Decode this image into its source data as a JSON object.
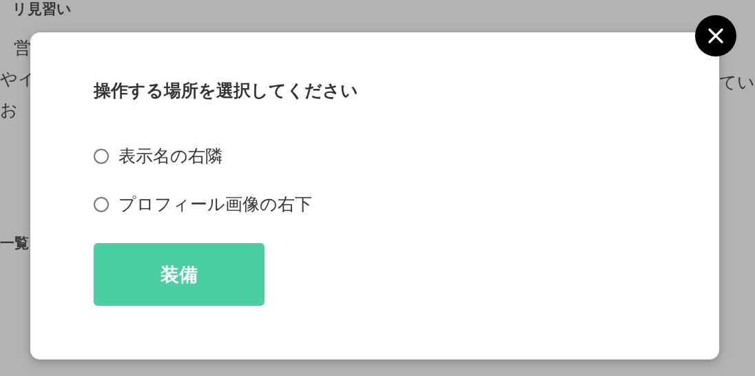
{
  "background": {
    "heading": "リ見習い",
    "lines": [
      "営",
      "やイ",
      "お"
    ],
    "section_heading": "一覧",
    "right_text": "てい"
  },
  "dialog": {
    "title": "操作する場所を選択してください",
    "options": [
      {
        "label": "表示名の右隣",
        "selected": false
      },
      {
        "label": "プロフィール画像の右下",
        "selected": false
      }
    ],
    "button": "装備"
  }
}
